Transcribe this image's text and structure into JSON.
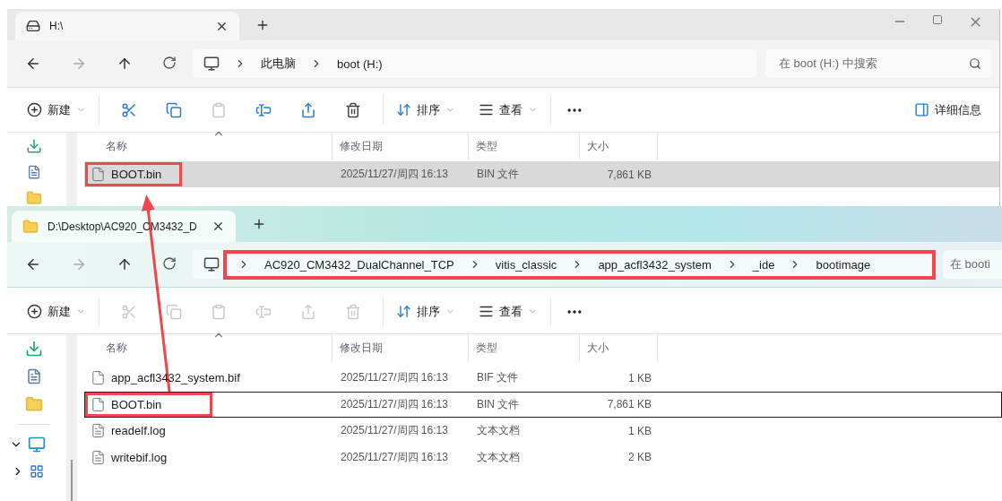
{
  "windows": [
    {
      "tab": {
        "title": "H:\\",
        "kind": "drive"
      },
      "nav": {
        "breadcrumb": [
          "此电脑",
          "boot (H:)"
        ],
        "marked": false,
        "search_placeholder": "在 boot (H:) 中搜索"
      },
      "toolbar": {
        "new_label": "新建",
        "actions": [
          {
            "kind": "cut",
            "disabled": false
          },
          {
            "kind": "copy",
            "disabled": false
          },
          {
            "kind": "paste",
            "disabled": true
          },
          {
            "kind": "rename",
            "disabled": false
          },
          {
            "kind": "share",
            "disabled": false
          },
          {
            "kind": "delete",
            "disabled": false
          }
        ],
        "sort_label": "排序",
        "view_label": "查看",
        "details_label": "详细信息"
      },
      "sidebar": [
        {
          "kind": "downloads"
        },
        {
          "kind": "documents"
        },
        {
          "kind": "folder"
        }
      ],
      "columns": [
        "名称",
        "修改日期",
        "类型",
        "大小"
      ],
      "files": [
        {
          "name": "BOOT.bin",
          "date": "2025/11/27/周四 16:13",
          "type": "BIN 文件",
          "size": "7,861 KB",
          "kind": "binary",
          "selected": true,
          "focused": false,
          "marked": true
        }
      ]
    },
    {
      "tab": {
        "title": "D:\\Desktop\\AC920_CM3432_D",
        "kind": "folder"
      },
      "nav": {
        "breadcrumb": [
          "AC920_CM3432_DualChannel_TCP",
          "vitis_classic",
          "app_acfl3432_system",
          "_ide",
          "bootimage"
        ],
        "marked": true,
        "search_placeholder": "在 booti"
      },
      "toolbar": {
        "new_label": "新建",
        "actions": [
          {
            "kind": "cut",
            "disabled": true
          },
          {
            "kind": "copy",
            "disabled": true
          },
          {
            "kind": "paste",
            "disabled": true
          },
          {
            "kind": "rename",
            "disabled": true
          },
          {
            "kind": "share",
            "disabled": true
          },
          {
            "kind": "delete",
            "disabled": true
          }
        ],
        "sort_label": "排序",
        "view_label": "查看"
      },
      "sidebar": [
        {
          "kind": "downloads"
        },
        {
          "kind": "documents"
        },
        {
          "kind": "folder"
        },
        {
          "kind": "divider"
        },
        {
          "kind": "pc",
          "expanded": true
        },
        {
          "kind": "network",
          "expanded": false
        }
      ],
      "columns": [
        "名称",
        "修改日期",
        "类型",
        "大小"
      ],
      "files": [
        {
          "name": "app_acfl3432_system.bif",
          "date": "2025/11/27/周四 16:13",
          "type": "BIF 文件",
          "size": "1 KB",
          "kind": "binary",
          "selected": false,
          "focused": false,
          "marked": false
        },
        {
          "name": "BOOT.bin",
          "date": "2025/11/27/周四 16:13",
          "type": "BIN 文件",
          "size": "7,861 KB",
          "kind": "binary",
          "selected": false,
          "focused": true,
          "marked": true
        },
        {
          "name": "readelf.log",
          "date": "2025/11/27/周四 16:13",
          "type": "文本文档",
          "size": "1 KB",
          "kind": "text",
          "selected": false,
          "focused": false,
          "marked": false
        },
        {
          "name": "writebif.log",
          "date": "2025/11/27/周四 16:13",
          "type": "文本文档",
          "size": "2 KB",
          "kind": "text",
          "selected": false,
          "focused": false,
          "marked": false
        }
      ]
    }
  ]
}
